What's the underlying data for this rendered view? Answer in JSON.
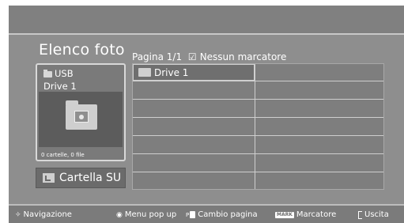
{
  "header": {
    "title": "Elenco foto",
    "page_label": "Pagina 1/1",
    "marker_checkbox": "☑",
    "marker_status": "Nessun marcatore"
  },
  "device_card": {
    "device_name": "USB",
    "drive_name": "Drive 1",
    "stats": "0 cartelle, 0 file"
  },
  "up_button": {
    "label": "Cartella SU"
  },
  "grid": {
    "items": [
      {
        "label": "Drive 1",
        "icon": "folder-icon"
      }
    ]
  },
  "footer": {
    "navigation": {
      "glyph": "✧",
      "label": "Navigazione"
    },
    "menu_popup": {
      "glyph": "◉",
      "label": "Menu pop up"
    },
    "page_change": {
      "key": "P",
      "label": "Cambio pagina"
    },
    "marker": {
      "badge": "MARK",
      "label": "Marcatore"
    },
    "exit": {
      "label": "Uscita"
    }
  },
  "colors": {
    "background": "#8e8e8e",
    "text": "#ffffff",
    "selection": "#6f6f6f"
  }
}
